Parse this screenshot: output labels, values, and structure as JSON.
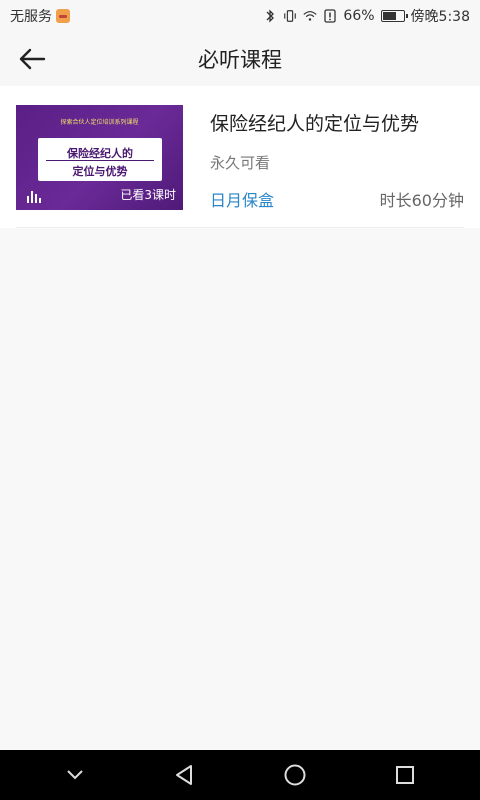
{
  "status_bar": {
    "carrier": "无服务",
    "battery_percent": "66%",
    "battery_level": 0.66,
    "time": "傍晚5:38",
    "icons": [
      "app-badge-icon",
      "bluetooth-icon",
      "vibrate-icon",
      "wifi-icon",
      "alert-icon",
      "battery-icon"
    ]
  },
  "header": {
    "title": "必听课程",
    "back_icon": "arrow-left-icon"
  },
  "courses": [
    {
      "thumbnail": {
        "caption": "探索合伙人定位培训系列课程",
        "line1": "保险经纪人的",
        "line2": "定位与优势",
        "watched": "已看3课时"
      },
      "title": "保险经纪人的定位与优势",
      "access": "永久可看",
      "provider": "日月保盒",
      "duration": "时长60分钟"
    }
  ],
  "colors": {
    "accent": "#2a86c8",
    "thumb_purple": "#5a1f86"
  },
  "nav_bar": {
    "icons": [
      "chevron-down-icon",
      "back-triangle-icon",
      "home-circle-icon",
      "recents-square-icon"
    ]
  }
}
